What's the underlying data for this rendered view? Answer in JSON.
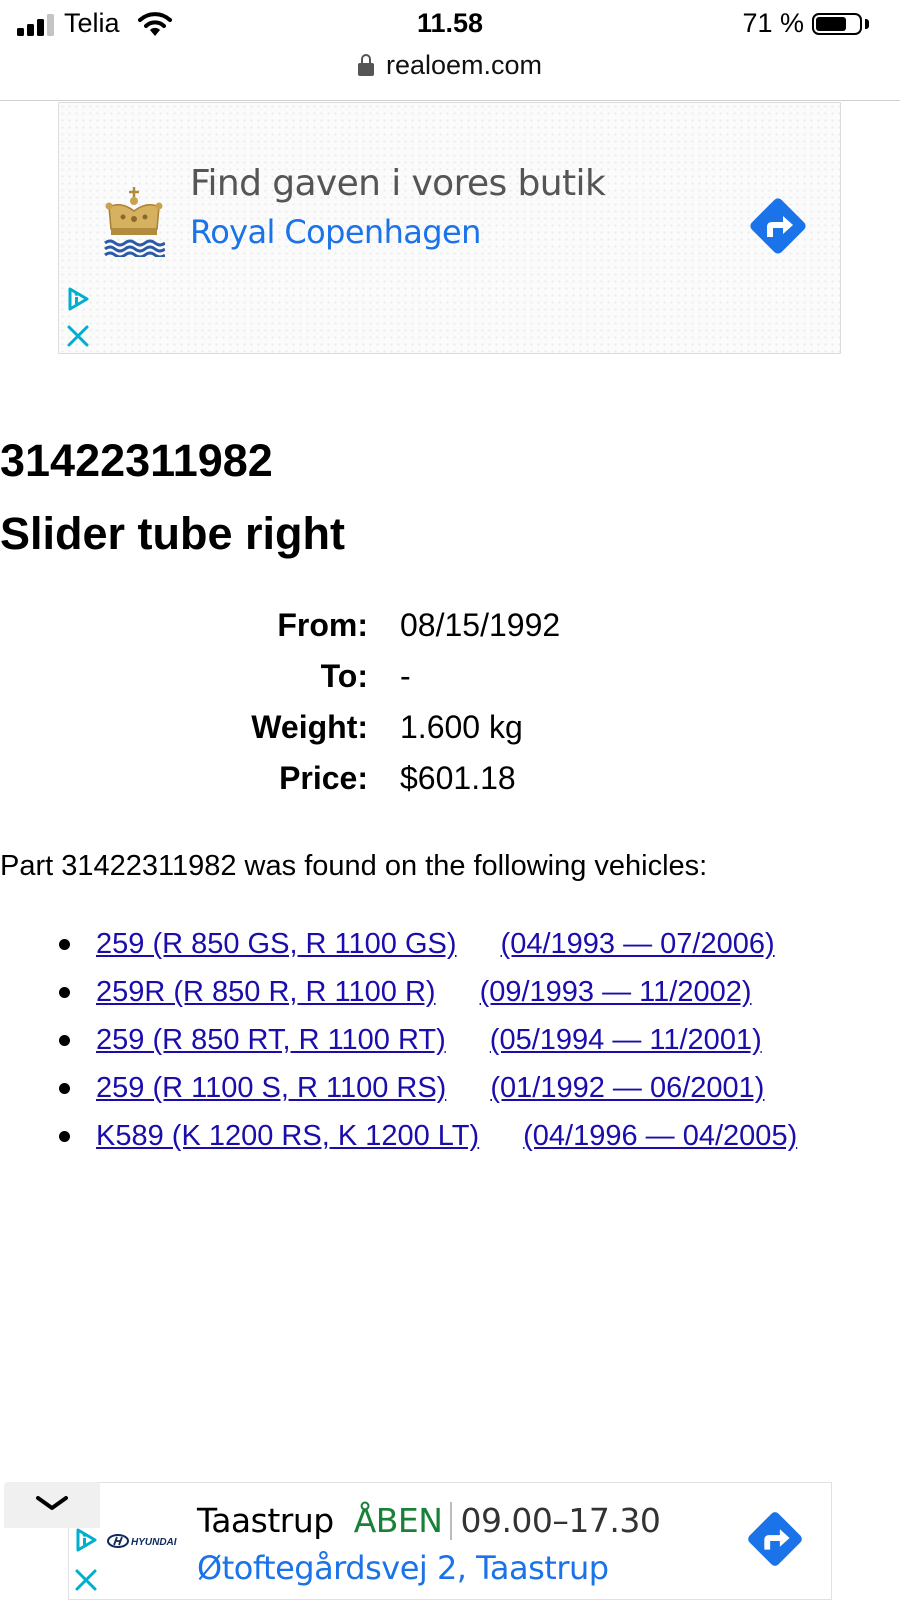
{
  "status_bar": {
    "carrier": "Telia",
    "time": "11.58",
    "battery_percent": "71 %",
    "battery_level": 0.71,
    "signal_bars": 3
  },
  "browser": {
    "url": "realoem.com"
  },
  "ad_top": {
    "headline": "Find gaven i vores butik",
    "advertiser": "Royal Copenhagen",
    "accent_color": "#1a73e8"
  },
  "part": {
    "number": "31422311982",
    "name": "Slider tube right",
    "details": [
      {
        "label": "From:",
        "value": "08/15/1992"
      },
      {
        "label": "To:",
        "value": "-"
      },
      {
        "label": "Weight:",
        "value": "1.600 kg"
      },
      {
        "label": "Price:",
        "value": "$601.18"
      }
    ],
    "found_text": "Part 31422311982 was found on the following vehicles:",
    "vehicles": [
      {
        "model": "259 (R 850 GS, R 1100 GS)",
        "range": "(04/1993 — 07/2006)"
      },
      {
        "model": "259R (R 850 R, R 1100 R)",
        "range": "(09/1993 — 11/2002)"
      },
      {
        "model": "259 (R 850 RT, R 1100 RT)",
        "range": "(05/1994 — 11/2001)"
      },
      {
        "model": "259 (R 1100 S, R 1100 RS)",
        "range": "(01/1992 — 06/2001)"
      },
      {
        "model": "K589 (K 1200 RS, K 1200 LT)",
        "range": "(04/1996 — 04/2005)"
      }
    ],
    "link_color": "#1a0dab"
  },
  "ad_bottom": {
    "brand": "HYUNDAI",
    "location": "Taastrup",
    "open_label": "ÅBEN",
    "hours": "09.00–17.30",
    "address": "Øtoftegårdsvej 2, Taastrup",
    "open_color": "#188038"
  },
  "icons": [
    "signal-icon",
    "wifi-icon",
    "battery-icon",
    "lock-icon",
    "crown-logo-icon",
    "directions-arrow-icon",
    "adchoices-icon",
    "close-icon",
    "chevron-down-icon",
    "hyundai-logo-icon"
  ]
}
